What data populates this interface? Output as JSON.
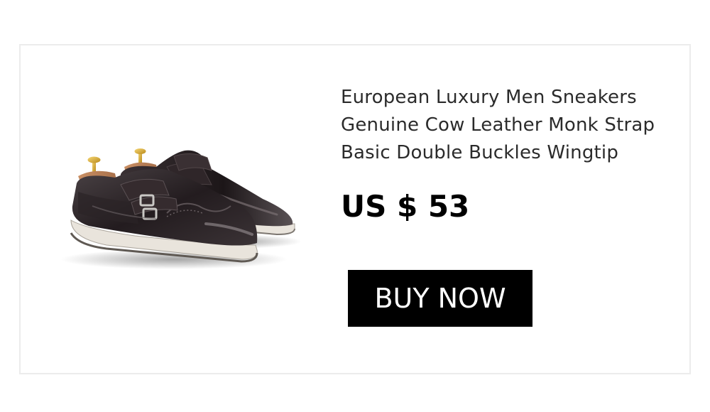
{
  "product": {
    "title_lines": [
      "European Luxury Men Sneakers",
      "Genuine Cow Leather Monk Strap",
      "Basic Double Buckles Wingtip"
    ],
    "price": "US $ 53",
    "buy_label": "BUY NOW",
    "image_icon": "monk-strap-shoes-image"
  },
  "colors": {
    "button_bg": "#000000",
    "button_text": "#ffffff",
    "leather": "#2a2326",
    "sole": "#e9e4dc",
    "card_border": "#ececec"
  }
}
